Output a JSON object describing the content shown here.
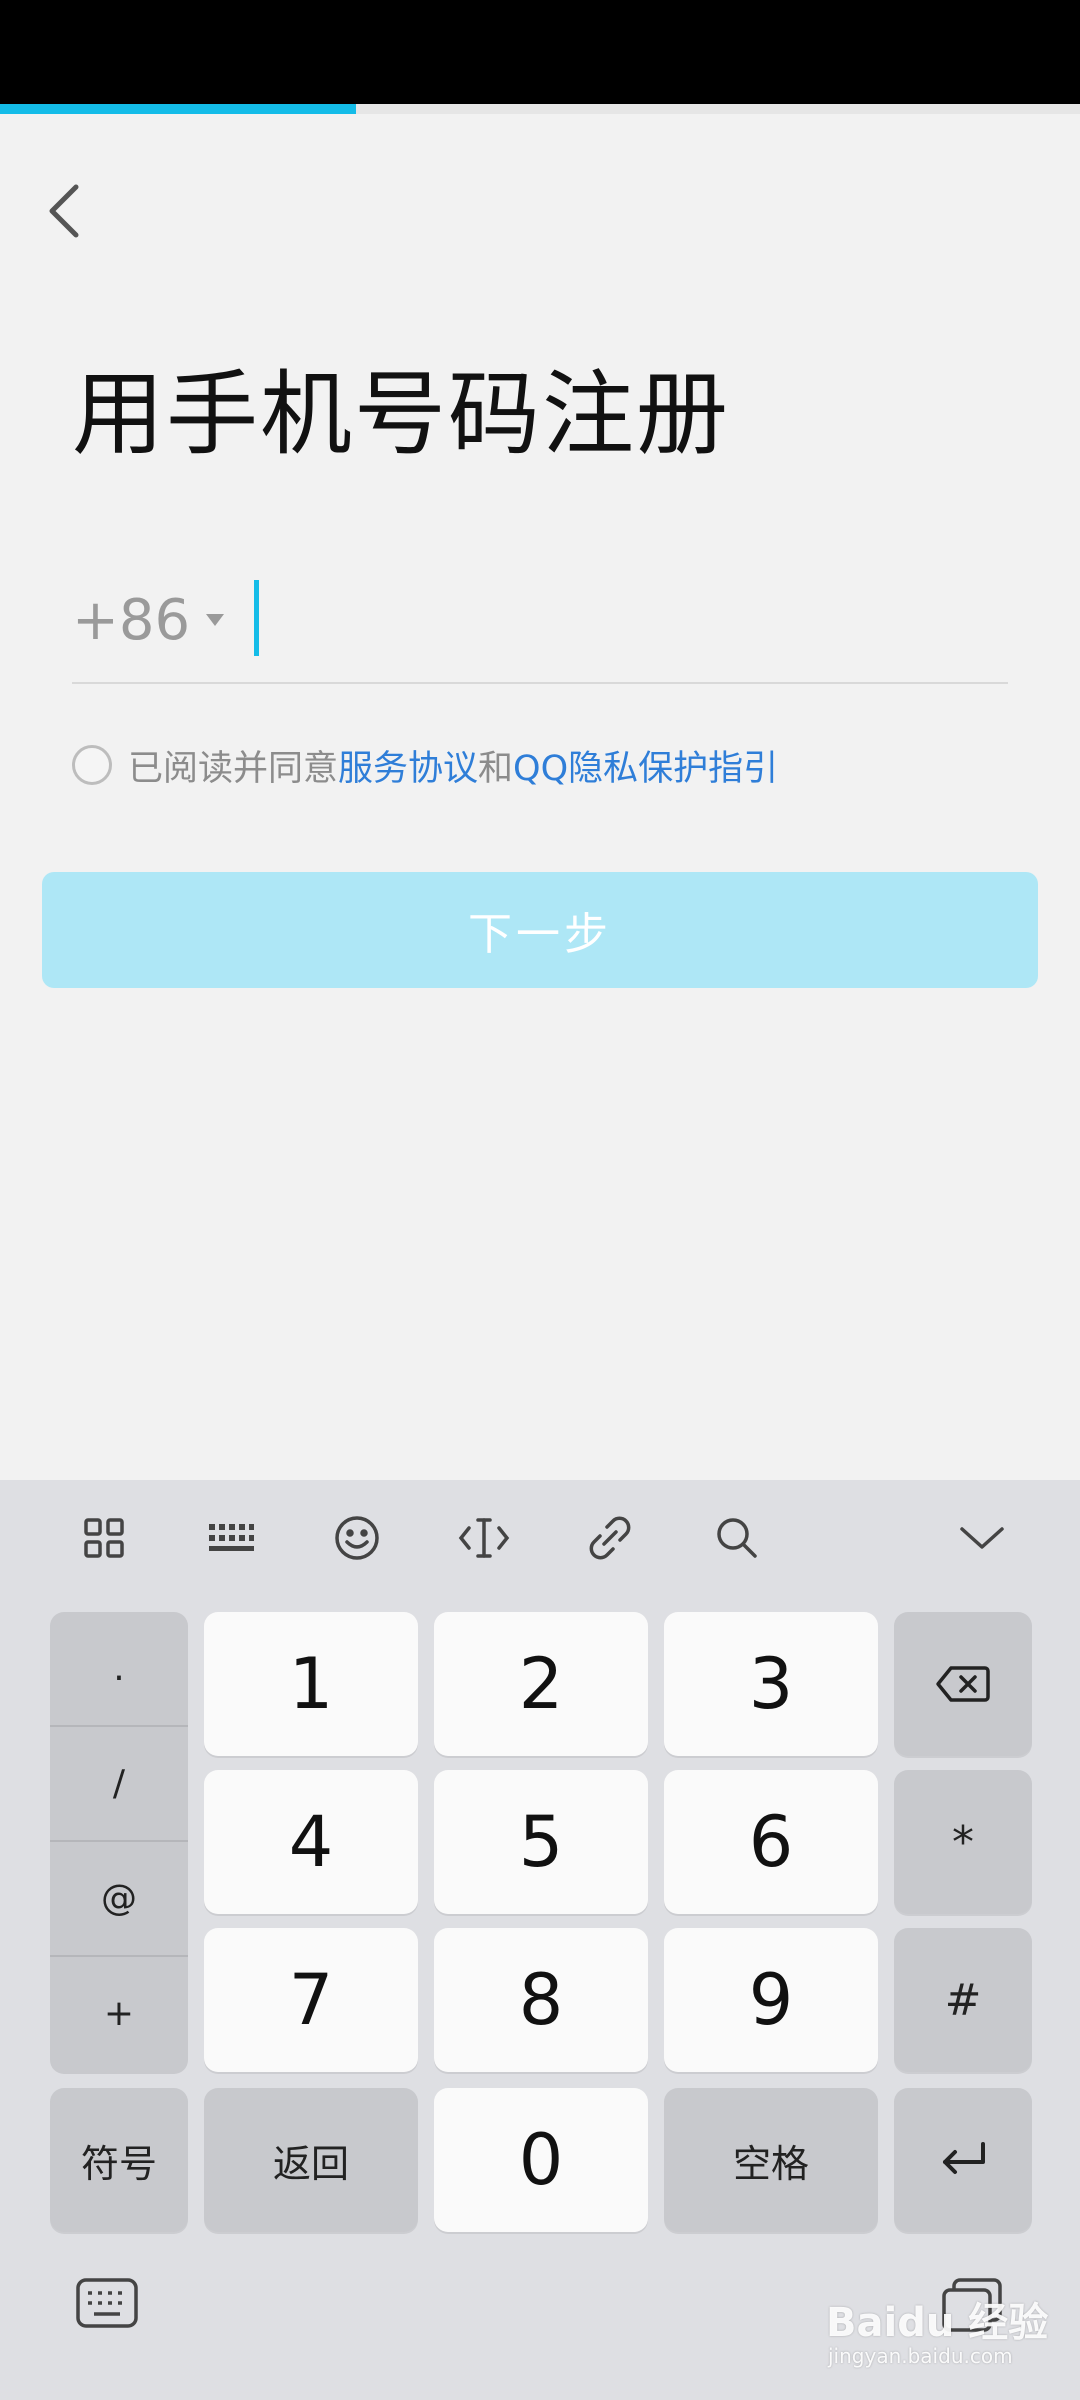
{
  "progress": {
    "fraction": 0.33
  },
  "header": {
    "back_icon": "chevron-left-icon"
  },
  "page": {
    "title": "用手机号码注册"
  },
  "phone": {
    "country_code": "+86",
    "dropdown_icon": "caret-down-icon",
    "value": ""
  },
  "agreement": {
    "prefix": "已阅读并同意",
    "service_link": "服务协议",
    "and": "和",
    "privacy_link": "QQ隐私保护指引"
  },
  "next_button": {
    "label": "下一步",
    "color": "#aee7f6"
  },
  "keyboard": {
    "toolbar_icons": [
      "grid-icon",
      "keyboard-layout-icon",
      "emoji-icon",
      "cursor-icon",
      "link-icon",
      "search-icon",
      "collapse-icon"
    ],
    "symbols": [
      ".",
      "/",
      "@",
      "+"
    ],
    "digits": [
      "1",
      "2",
      "3",
      "4",
      "5",
      "6",
      "7",
      "8",
      "9",
      "0"
    ],
    "symbols_key": "符号",
    "back_key": "返回",
    "space_key": "空格",
    "star_key": "*",
    "hash_key": "#",
    "backspace_icon": "backspace-icon",
    "enter_icon": "enter-icon"
  },
  "watermark": {
    "brand": "Baidu 经验",
    "url": "jingyan.baidu.com"
  },
  "colors": {
    "accent": "#14bce8",
    "link": "#2f7ed8",
    "background": "#f2f2f2",
    "keyboard_bg": "#dedfe3"
  }
}
